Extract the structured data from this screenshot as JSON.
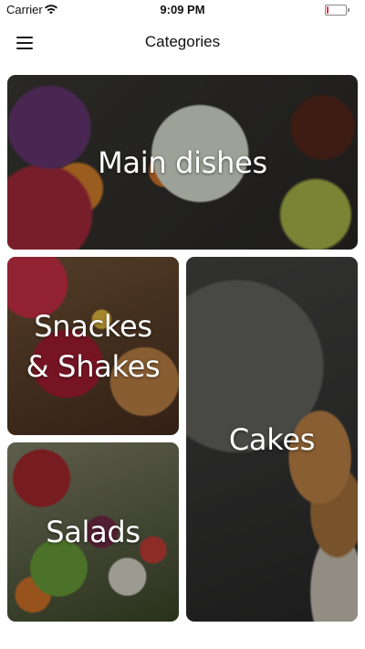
{
  "status_bar": {
    "carrier": "Carrier",
    "time": "9:09 PM",
    "battery_level_percent": 10,
    "battery_color": "#e0303a"
  },
  "nav": {
    "title": "Categories",
    "menu_icon": "hamburger-menu-icon"
  },
  "categories": [
    {
      "label": "Main dishes"
    },
    {
      "label": "Snackes & Shakes"
    },
    {
      "label": "Salads"
    },
    {
      "label": "Cakes"
    }
  ]
}
